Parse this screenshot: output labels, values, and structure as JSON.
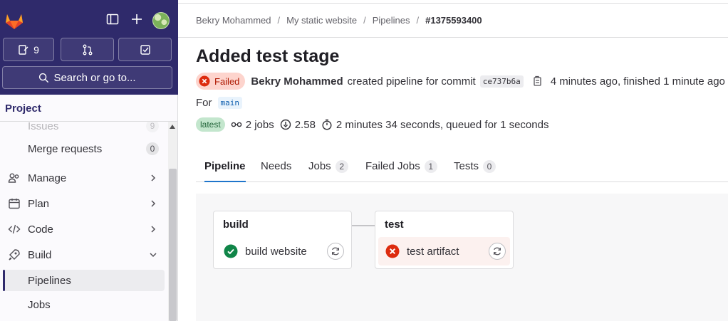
{
  "sidebar": {
    "issues_count": "9",
    "search_placeholder": "Search or go to...",
    "project_label": "Project",
    "nav": {
      "issues_label": "Issues",
      "issues_count": "9",
      "merge_requests_label": "Merge requests",
      "merge_requests_count": "0",
      "manage_label": "Manage",
      "plan_label": "Plan",
      "code_label": "Code",
      "build_label": "Build",
      "pipelines_label": "Pipelines",
      "jobs_label": "Jobs"
    }
  },
  "breadcrumb": {
    "items": [
      "Bekry Mohammed",
      "My static website",
      "Pipelines",
      "#1375593400"
    ]
  },
  "pipeline": {
    "title": "Added test stage",
    "status": "Failed",
    "author": "Bekry Mohammed",
    "created_text": "created pipeline for commit",
    "commit": "ce737b6a",
    "timing": "4 minutes ago, finished 1 minute ago",
    "for_label": "For",
    "branch": "main",
    "latest_badge": "latest",
    "jobs_count": "2 jobs",
    "score": "2.58",
    "duration": "2 minutes 34 seconds, queued for 1 seconds"
  },
  "tabs": [
    {
      "label": "Pipeline",
      "count": null
    },
    {
      "label": "Needs",
      "count": null
    },
    {
      "label": "Jobs",
      "count": "2"
    },
    {
      "label": "Failed Jobs",
      "count": "1"
    },
    {
      "label": "Tests",
      "count": "0"
    }
  ],
  "stages": [
    {
      "name": "build",
      "job": "build website",
      "status": "success"
    },
    {
      "name": "test",
      "job": "test artifact",
      "status": "failed"
    }
  ],
  "colors": {
    "sidebar_top": "#2f2a6b",
    "failed": "#dd2b0e",
    "success": "#108548",
    "tab_active": "#1f75cb"
  }
}
